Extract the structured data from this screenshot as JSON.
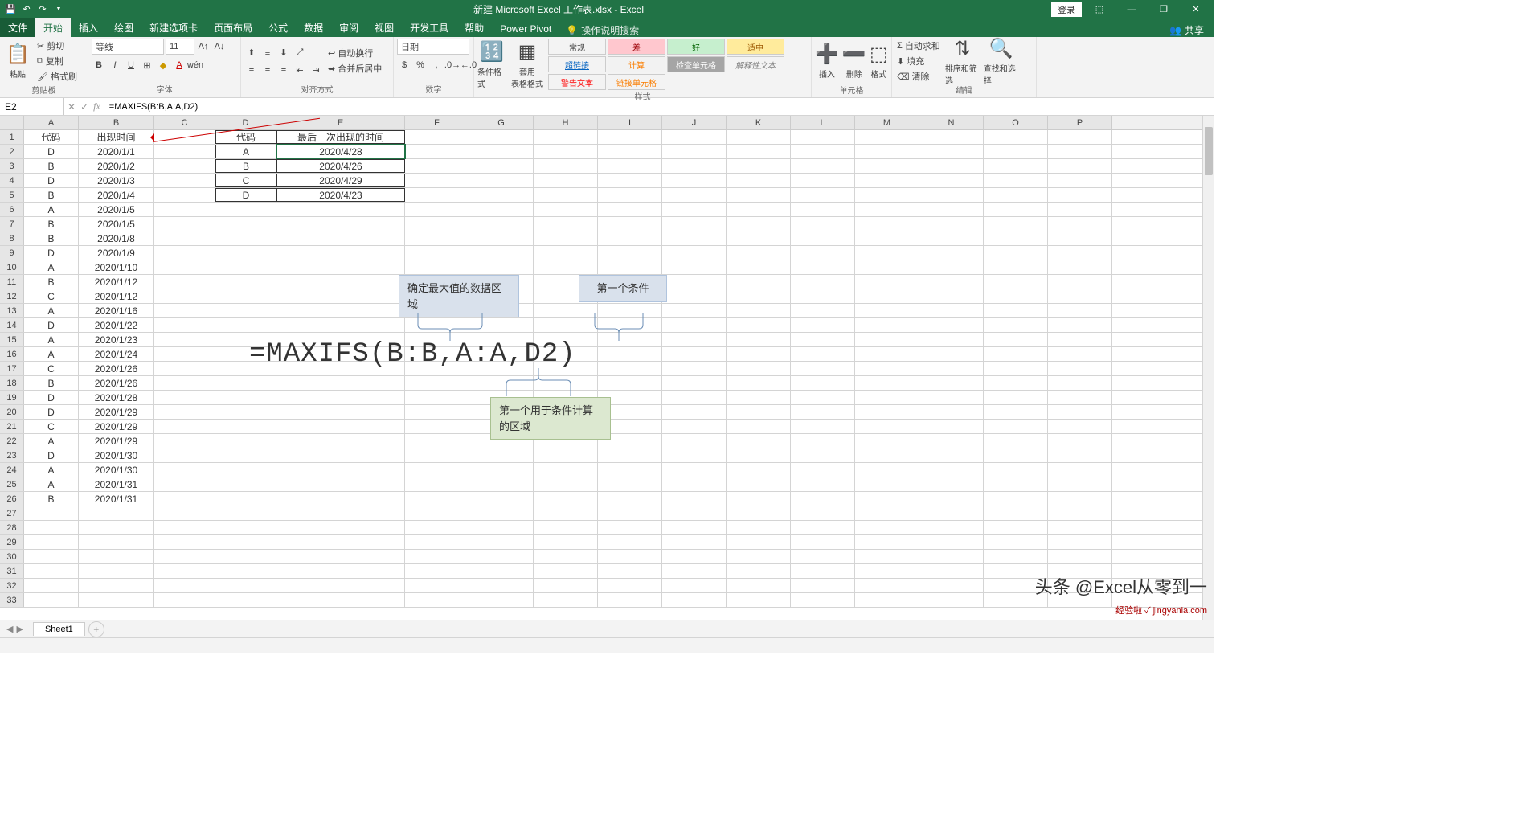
{
  "titlebar": {
    "filename": "新建 Microsoft Excel 工作表.xlsx  -  Excel",
    "login": "登录"
  },
  "tabs": {
    "file": "文件",
    "home": "开始",
    "insert": "插入",
    "draw": "绘图",
    "newtab": "新建选项卡",
    "layout": "页面布局",
    "formulas": "公式",
    "data": "数据",
    "review": "审阅",
    "view": "视图",
    "dev": "开发工具",
    "help": "帮助",
    "powerpivot": "Power Pivot",
    "tell_me": "操作说明搜索",
    "share": "共享"
  },
  "ribbon": {
    "clipboard": {
      "label": "剪贴板",
      "paste": "粘贴",
      "cut": "剪切",
      "copy": "复制",
      "painter": "格式刷"
    },
    "font": {
      "label": "字体",
      "name": "等线",
      "size": "11"
    },
    "align": {
      "label": "对齐方式",
      "wrap": "自动换行",
      "merge": "合并后居中"
    },
    "number": {
      "label": "数字",
      "format": "日期"
    },
    "styles": {
      "label": "样式",
      "cond": "条件格式",
      "table": "套用\n表格格式",
      "normal": "常规",
      "bad": "差",
      "good": "好",
      "neutral": "适中",
      "link": "超链接",
      "calc": "计算",
      "check": "检查单元格",
      "explain": "解释性文本",
      "warn": "警告文本",
      "linked": "链接单元格"
    },
    "cells": {
      "label": "单元格",
      "insert": "插入",
      "delete": "删除",
      "format": "格式"
    },
    "editing": {
      "label": "编辑",
      "autosum": "自动求和",
      "fill": "填充",
      "clear": "清除",
      "sort": "排序和筛选",
      "find": "查找和选择"
    }
  },
  "formula_bar": {
    "ref": "E2",
    "formula": "=MAXIFS(B:B,A:A,D2)"
  },
  "columns": [
    "A",
    "B",
    "C",
    "D",
    "E",
    "F",
    "G",
    "H",
    "I",
    "J",
    "K",
    "L",
    "M",
    "N",
    "O",
    "P"
  ],
  "headers": {
    "A1": "代码",
    "B1": "出现时间",
    "D1": "代码",
    "E1": "最后一次出现的时间"
  },
  "dataAB": [
    [
      "D",
      "2020/1/1"
    ],
    [
      "B",
      "2020/1/2"
    ],
    [
      "D",
      "2020/1/3"
    ],
    [
      "B",
      "2020/1/4"
    ],
    [
      "A",
      "2020/1/5"
    ],
    [
      "B",
      "2020/1/5"
    ],
    [
      "B",
      "2020/1/8"
    ],
    [
      "D",
      "2020/1/9"
    ],
    [
      "A",
      "2020/1/10"
    ],
    [
      "B",
      "2020/1/12"
    ],
    [
      "C",
      "2020/1/12"
    ],
    [
      "A",
      "2020/1/16"
    ],
    [
      "D",
      "2020/1/22"
    ],
    [
      "A",
      "2020/1/23"
    ],
    [
      "A",
      "2020/1/24"
    ],
    [
      "C",
      "2020/1/26"
    ],
    [
      "B",
      "2020/1/26"
    ],
    [
      "D",
      "2020/1/28"
    ],
    [
      "D",
      "2020/1/29"
    ],
    [
      "C",
      "2020/1/29"
    ],
    [
      "A",
      "2020/1/29"
    ],
    [
      "D",
      "2020/1/30"
    ],
    [
      "A",
      "2020/1/30"
    ],
    [
      "A",
      "2020/1/31"
    ],
    [
      "B",
      "2020/1/31"
    ]
  ],
  "dataDE": [
    [
      "A",
      "2020/4/28"
    ],
    [
      "B",
      "2020/4/26"
    ],
    [
      "C",
      "2020/4/29"
    ],
    [
      "D",
      "2020/4/23"
    ]
  ],
  "annotations": {
    "formula": "=MAXIFS(B:B,A:A,D2)",
    "box1": "确定最大值的数据区域",
    "box2": "第一个条件",
    "box3": "第一个用于条件计算的区域"
  },
  "sheet_tab": "Sheet1",
  "watermark": "头条 @Excel从零到一",
  "watermark2": "经验啦 ✓ jingyanla.com"
}
